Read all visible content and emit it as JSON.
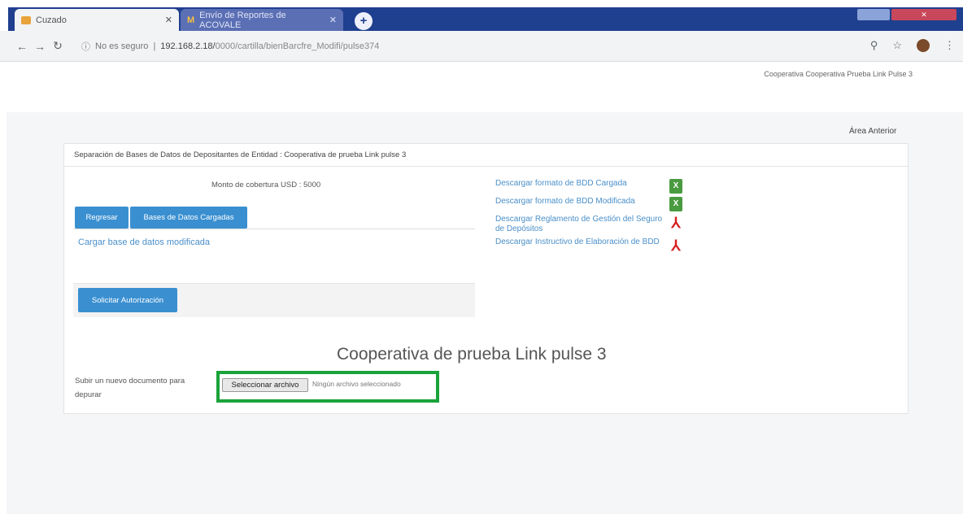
{
  "browser": {
    "active_tab": "Cuzado",
    "inactive_tab": "Envío de Reportes de ACOVALE",
    "url_prefix": "No es seguro",
    "url": "192.168.2.18/",
    "url_rest": "0000/cartilla/bienBarcfre_Modifi/pulse374"
  },
  "header": {
    "username": "Cooperativa Cooperativa Prueba Link Pulse 3"
  },
  "page": {
    "previous_link": "Área Anterior",
    "panel_title": "Separación de Bases de Datos de Depositantes de Entidad : Cooperativa de prueba Link pulse 3",
    "coverage_amount": "Monto de cobertura USD : 5000",
    "btn_regresar": "Regresar",
    "btn_bases": "Bases de Datos Cargadas",
    "link_cargar": "Cargar base de datos modificada",
    "btn_solicitar": "Solicitar Autorización",
    "downloads": [
      {
        "label": "Descargar formato de BDD Cargada",
        "icon": "excel-icon"
      },
      {
        "label": "Descargar formato de BDD Modificada",
        "icon": "excel-icon"
      },
      {
        "label": "Descargar Reglamento de Gestión del Seguro de Depósitos",
        "icon": "pdf-icon"
      },
      {
        "label": "Descargar Instructivo de Elaboración de BDD",
        "icon": "pdf-icon"
      }
    ],
    "coop_title": "Cooperativa de prueba Link pulse 3",
    "upload_label": "Subir un nuevo documento para depurar",
    "file_button": "Seleccionar archivo",
    "file_none": "Ningún archivo seleccionado"
  },
  "colors": {
    "primary_button": "#3a8fd0",
    "link": "#4a8fc9",
    "highlight": "#1aa33a"
  }
}
